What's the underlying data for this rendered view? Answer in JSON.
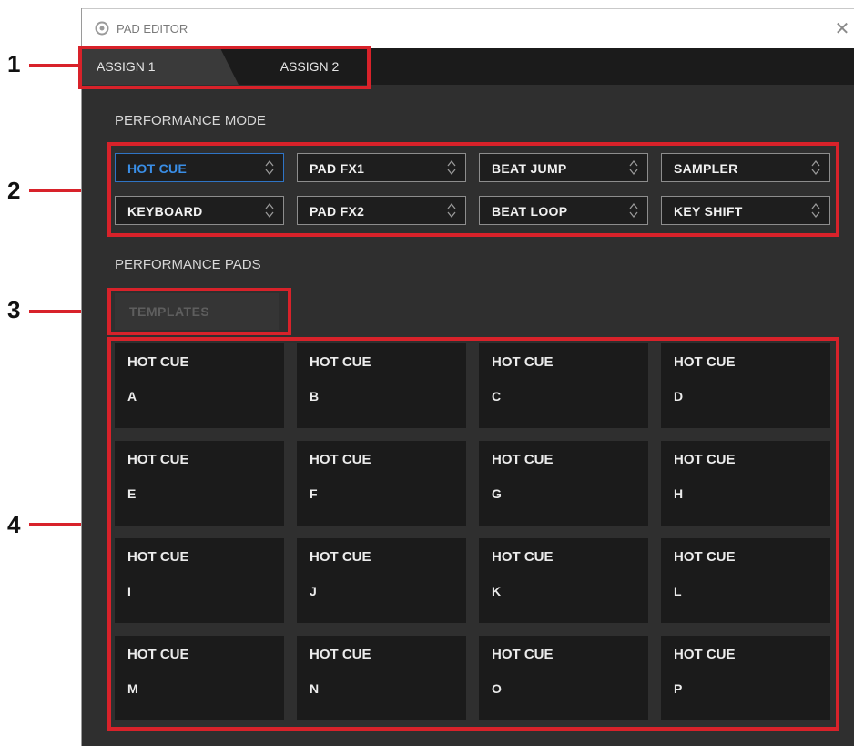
{
  "window": {
    "title": "PAD EDITOR",
    "icons": {
      "app": "gear-icon",
      "close": "close-icon"
    },
    "close_glyph": "✕"
  },
  "tabs": [
    {
      "label": "ASSIGN 1",
      "selected": true
    },
    {
      "label": "ASSIGN 2",
      "selected": false
    }
  ],
  "performance_mode": {
    "label": "PERFORMANCE MODE",
    "modes": [
      {
        "label": "HOT CUE",
        "active": true
      },
      {
        "label": "PAD FX1",
        "active": false
      },
      {
        "label": "BEAT JUMP",
        "active": false
      },
      {
        "label": "SAMPLER",
        "active": false
      },
      {
        "label": "KEYBOARD",
        "active": false
      },
      {
        "label": "PAD FX2",
        "active": false
      },
      {
        "label": "BEAT LOOP",
        "active": false
      },
      {
        "label": "KEY SHIFT",
        "active": false
      }
    ]
  },
  "performance_pads": {
    "label": "PERFORMANCE PADS",
    "templates_label": "TEMPLATES",
    "pads": [
      {
        "mode": "HOT CUE",
        "letter": "A"
      },
      {
        "mode": "HOT CUE",
        "letter": "B"
      },
      {
        "mode": "HOT CUE",
        "letter": "C"
      },
      {
        "mode": "HOT CUE",
        "letter": "D"
      },
      {
        "mode": "HOT CUE",
        "letter": "E"
      },
      {
        "mode": "HOT CUE",
        "letter": "F"
      },
      {
        "mode": "HOT CUE",
        "letter": "G"
      },
      {
        "mode": "HOT CUE",
        "letter": "H"
      },
      {
        "mode": "HOT CUE",
        "letter": "I"
      },
      {
        "mode": "HOT CUE",
        "letter": "J"
      },
      {
        "mode": "HOT CUE",
        "letter": "K"
      },
      {
        "mode": "HOT CUE",
        "letter": "L"
      },
      {
        "mode": "HOT CUE",
        "letter": "M"
      },
      {
        "mode": "HOT CUE",
        "letter": "N"
      },
      {
        "mode": "HOT CUE",
        "letter": "O"
      },
      {
        "mode": "HOT CUE",
        "letter": "P"
      }
    ]
  },
  "callouts": [
    "1",
    "2",
    "3",
    "4"
  ],
  "colors": {
    "highlight": "#d8222a",
    "active_mode": "#3a8ee6",
    "window_bg": "#2f2f2f",
    "pad_bg": "#1b1b1b"
  }
}
